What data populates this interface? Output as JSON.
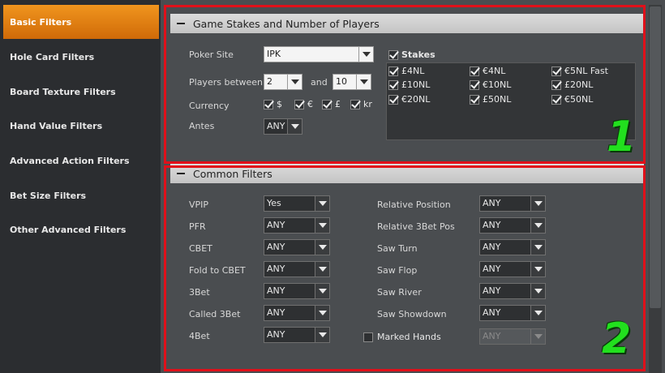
{
  "sidebar": {
    "items": [
      {
        "label": "Basic Filters",
        "active": true
      },
      {
        "label": "Hole Card Filters"
      },
      {
        "label": "Board Texture Filters"
      },
      {
        "label": "Hand Value Filters"
      },
      {
        "label": "Advanced Action Filters"
      },
      {
        "label": "Bet Size Filters"
      },
      {
        "label": "Other Advanced Filters"
      }
    ]
  },
  "game_stakes": {
    "title": "Game Stakes and Number of Players",
    "poker_site_label": "Poker Site",
    "poker_site_value": "IPK",
    "players_between_label": "Players between",
    "players_min": "2",
    "players_and": "and",
    "players_max": "10",
    "currency_label": "Currency",
    "currencies": [
      {
        "label": "$",
        "checked": true
      },
      {
        "label": "€",
        "checked": true
      },
      {
        "label": "£",
        "checked": true
      },
      {
        "label": "kr",
        "checked": true
      }
    ],
    "antes_label": "Antes",
    "antes_value": "ANY",
    "stakes_label": "Stakes",
    "stakes_checked": true,
    "stakes": [
      {
        "label": "£4NL",
        "checked": true
      },
      {
        "label": "€4NL",
        "checked": true
      },
      {
        "label": "€5NL Fast",
        "checked": true
      },
      {
        "label": "£10NL",
        "checked": true
      },
      {
        "label": "€10NL",
        "checked": true
      },
      {
        "label": "£20NL",
        "checked": true
      },
      {
        "label": "€20NL",
        "checked": true
      },
      {
        "label": "£50NL",
        "checked": true
      },
      {
        "label": "€50NL",
        "checked": true
      }
    ]
  },
  "common_filters": {
    "title": "Common Filters",
    "left": [
      {
        "label": "VPIP",
        "value": "Yes"
      },
      {
        "label": "PFR",
        "value": "ANY"
      },
      {
        "label": "CBET",
        "value": "ANY"
      },
      {
        "label": "Fold to CBET",
        "value": "ANY"
      },
      {
        "label": "3Bet",
        "value": "ANY"
      },
      {
        "label": "Called 3Bet",
        "value": "ANY"
      },
      {
        "label": "4Bet",
        "value": "ANY"
      }
    ],
    "right": [
      {
        "label": "Relative Position",
        "value": "ANY"
      },
      {
        "label": "Relative 3Bet Pos",
        "value": "ANY"
      },
      {
        "label": "Saw Turn",
        "value": "ANY"
      },
      {
        "label": "Saw Flop",
        "value": "ANY"
      },
      {
        "label": "Saw River",
        "value": "ANY"
      },
      {
        "label": "Saw Showdown",
        "value": "ANY"
      }
    ],
    "marked_hands_label": "Marked Hands",
    "marked_hands_checked": false,
    "marked_hands_value": "ANY"
  },
  "annotations": {
    "section1": "1",
    "section2": "2"
  },
  "colors": {
    "accent": "#e8820f",
    "annotation_frame": "#e0101a",
    "annotation_number": "#22e01e"
  }
}
